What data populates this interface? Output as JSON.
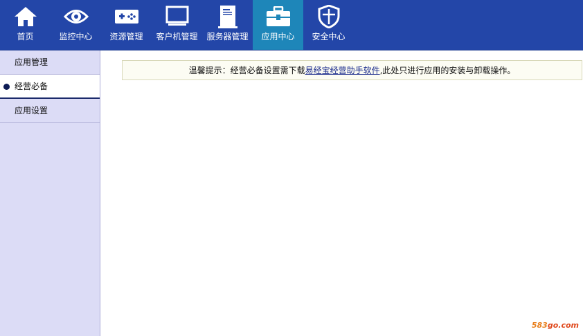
{
  "topnav": {
    "items": [
      {
        "label": "首页",
        "icon": "home-icon",
        "active": false
      },
      {
        "label": "监控中心",
        "icon": "eye-icon",
        "active": false
      },
      {
        "label": "资源管理",
        "icon": "gamepad-icon",
        "active": false
      },
      {
        "label": "客户机管理",
        "icon": "monitor-icon",
        "active": false
      },
      {
        "label": "服务器管理",
        "icon": "server-icon",
        "active": false
      },
      {
        "label": "应用中心",
        "icon": "toolbox-icon",
        "active": true
      },
      {
        "label": "安全中心",
        "icon": "shield-icon",
        "active": false
      }
    ]
  },
  "sidebar": {
    "items": [
      {
        "label": "应用管理",
        "active": false
      },
      {
        "label": "经营必备",
        "active": true
      },
      {
        "label": "应用设置",
        "active": false
      }
    ]
  },
  "notice": {
    "prefix": "温馨提示：经营必备设置需下载",
    "link": "易经宝经营助手软件",
    "suffix": ",此处只进行应用的安装与卸载操作。"
  },
  "watermark": {
    "num": "583",
    "txt": "go.com"
  },
  "colors": {
    "nav_bg": "#2346a8",
    "nav_active": "#1e86b9",
    "sidebar_bg": "#dcdcf6"
  }
}
